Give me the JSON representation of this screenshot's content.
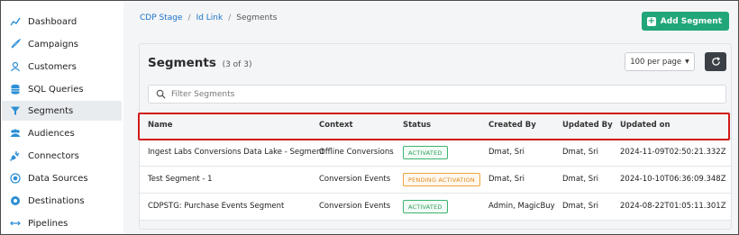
{
  "sidebar": {
    "items": [
      {
        "label": "Dashboard",
        "icon": "chart-line-icon"
      },
      {
        "label": "Campaigns",
        "icon": "rocket-icon"
      },
      {
        "label": "Customers",
        "icon": "customers-icon"
      },
      {
        "label": "SQL Queries",
        "icon": "database-icon"
      },
      {
        "label": "Segments",
        "icon": "filter-icon",
        "active": true
      },
      {
        "label": "Audiences",
        "icon": "users-icon"
      },
      {
        "label": "Connectors",
        "icon": "plug-icon"
      },
      {
        "label": "Data Sources",
        "icon": "data-source-icon"
      },
      {
        "label": "Destinations",
        "icon": "destination-icon"
      },
      {
        "label": "Pipelines",
        "icon": "pipeline-icon"
      }
    ]
  },
  "breadcrumb": {
    "items": [
      {
        "label": "CDP Stage"
      },
      {
        "label": "Id Link"
      },
      {
        "label": "Segments"
      }
    ],
    "separator": "/"
  },
  "header": {
    "add_button_label": "Add Segment"
  },
  "card": {
    "title": "Segments",
    "count": "(3 of 3)",
    "per_page": "100 per page",
    "search_placeholder": "Filter Segments"
  },
  "table": {
    "columns": [
      "Name",
      "Context",
      "Status",
      "Created By",
      "Updated By",
      "Updated on"
    ],
    "rows": [
      {
        "name": "Ingest Labs Conversions Data Lake - Segment",
        "context": "Offline Conversions",
        "status": "ACTIVATED",
        "status_type": "activated",
        "created_by": "Dmat, Sri",
        "updated_by": "Dmat, Sri",
        "updated_on": "2024-11-09T02:50:21.332Z"
      },
      {
        "name": "Test Segment - 1",
        "context": "Conversion Events",
        "status": "PENDING ACTIVATION",
        "status_type": "pending",
        "created_by": "Dmat, Sri",
        "updated_by": "Dmat, Sri",
        "updated_on": "2024-10-10T06:36:09.348Z"
      },
      {
        "name": "CDPSTG: Purchase Events Segment",
        "context": "Conversion Events",
        "status": "ACTIVATED",
        "status_type": "activated",
        "created_by": "Admin, MagicBuy",
        "updated_by": "Dmat, Sri",
        "updated_on": "2024-08-22T01:05:11.301Z"
      }
    ]
  },
  "colors": {
    "accent_green": "#21a67a",
    "link_blue": "#1a73c9",
    "highlight_red": "#d11a1a"
  }
}
